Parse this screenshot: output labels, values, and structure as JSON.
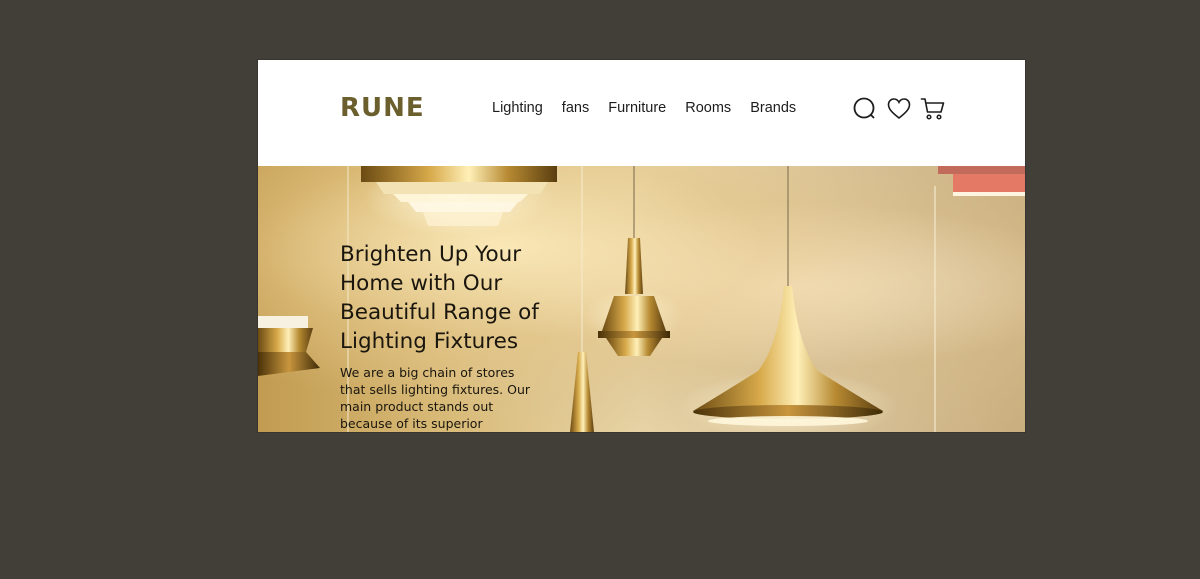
{
  "brand": {
    "logo": "RUNE",
    "accent_color": "#6b5f2e"
  },
  "nav": {
    "items": [
      "Lighting",
      "fans",
      "Furniture",
      "Rooms",
      "Brands"
    ]
  },
  "header_icons": [
    "search-icon",
    "heart-icon",
    "cart-icon"
  ],
  "hero": {
    "title": "Brighten Up Your Home with Our Beautiful Range of Lighting Fixtures",
    "description": "We are a big chain of stores that sells lighting fixtures. Our main product stands out because of its superior"
  }
}
